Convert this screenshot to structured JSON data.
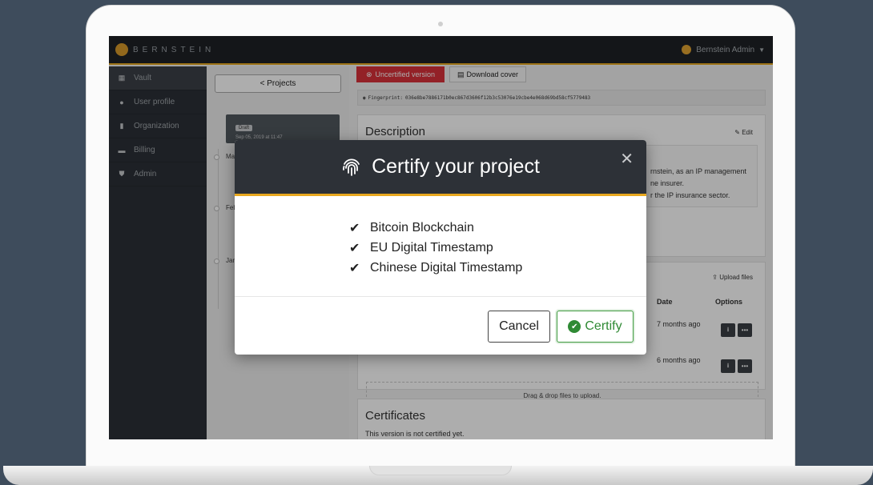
{
  "header": {
    "brand": "BERNSTEIN",
    "user": "Bernstein Admin"
  },
  "sidebar": {
    "items": [
      {
        "label": "Vault",
        "icon": "grid-icon",
        "active": true
      },
      {
        "label": "User profile",
        "icon": "user-icon"
      },
      {
        "label": "Organization",
        "icon": "building-icon"
      },
      {
        "label": "Billing",
        "icon": "credit-card-icon"
      },
      {
        "label": "Admin",
        "icon": "shield-icon"
      }
    ]
  },
  "projects": {
    "back_label": "< Projects",
    "draft_badge": "Draft",
    "draft_date": "Sep 05, 2019 at 11:47",
    "timeline_labels": [
      "Ma",
      "Feb",
      "Jar"
    ]
  },
  "main": {
    "uncertified_label": "Uncertified version",
    "download_label": "Download cover",
    "fingerprint_prefix": "Fingerprint:",
    "fingerprint_value": "036e8be7886171b0ec867d3606f12b3c53076e19cbe4e068d69bd58cf5779483",
    "description": {
      "title": "Description",
      "edit_label": "Edit",
      "text_lines": [
        "rnstein, as an IP management",
        "ne insurer.",
        "r the IP insurance sector."
      ]
    },
    "files": {
      "upload_label": "Upload files",
      "col_date": "Date",
      "col_options": "Options",
      "rows": [
        {
          "date": "7 months ago"
        },
        {
          "date": "6 months ago"
        }
      ],
      "drop_zone_label": "Drag & drop files to upload."
    },
    "certificates": {
      "title": "Certificates",
      "status": "This version is not certified yet."
    }
  },
  "modal": {
    "title": "Certify your project",
    "items": [
      "Bitcoin Blockchain",
      "EU Digital Timestamp",
      "Chinese Digital Timestamp"
    ],
    "cancel_label": "Cancel",
    "certify_label": "Certify"
  },
  "colors": {
    "accent": "#e8a81f",
    "danger": "#d9313a",
    "success": "#2f8a34",
    "sidebar": "#2b3037"
  }
}
